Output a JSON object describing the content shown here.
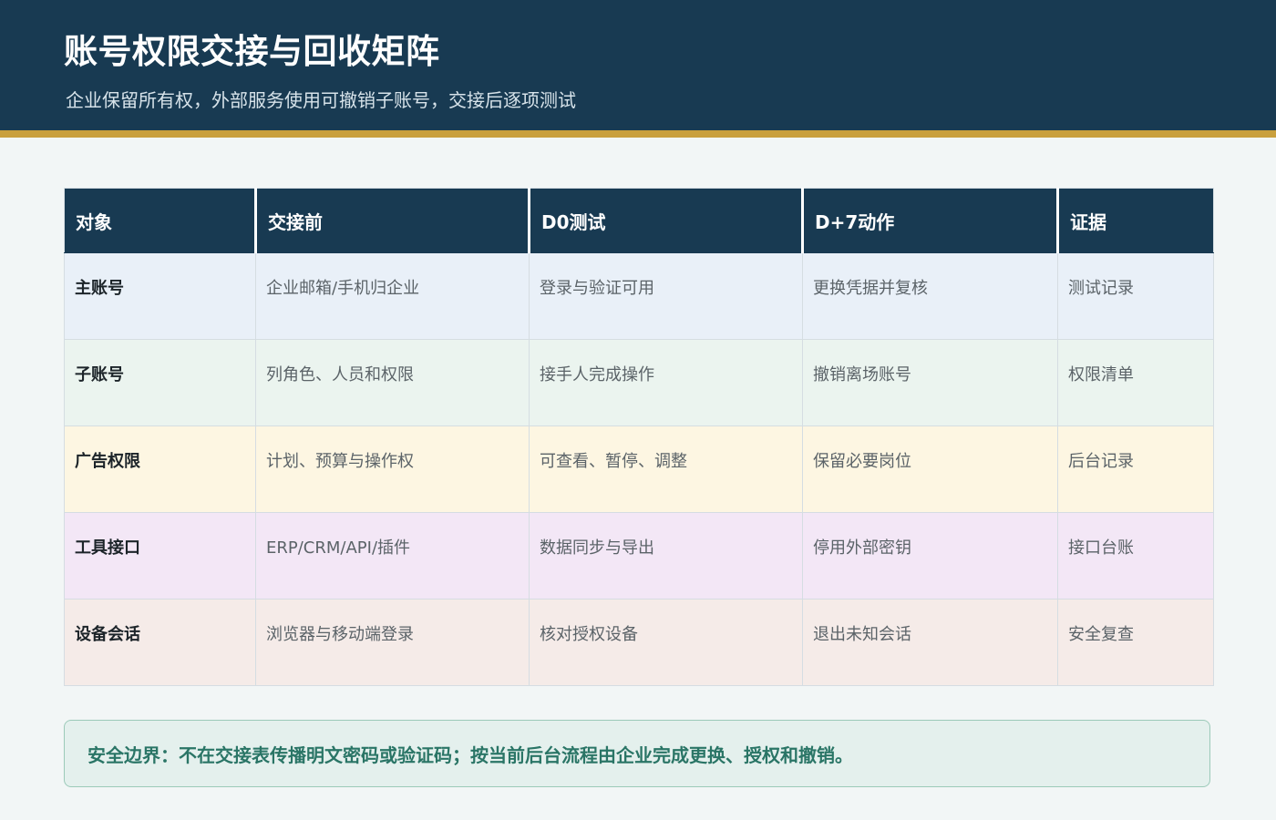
{
  "header": {
    "title": "账号权限交接与回收矩阵",
    "subtitle": "企业保留所有权，外部服务使用可撤销子账号，交接后逐项测试"
  },
  "table": {
    "columns": [
      "对象",
      "交接前",
      "D0测试",
      "D+7动作",
      "证据"
    ],
    "rows": [
      [
        "主账号",
        "企业邮箱/手机归企业",
        "登录与验证可用",
        "更换凭据并复核",
        "测试记录"
      ],
      [
        "子账号",
        "列角色、人员和权限",
        "接手人完成操作",
        "撤销离场账号",
        "权限清单"
      ],
      [
        "广告权限",
        "计划、预算与操作权",
        "可查看、暂停、调整",
        "保留必要岗位",
        "后台记录"
      ],
      [
        "工具接口",
        "ERP/CRM/API/插件",
        "数据同步与导出",
        "停用外部密钥",
        "接口台账"
      ],
      [
        "设备会话",
        "浏览器与移动端登录",
        "核对授权设备",
        "退出未知会话",
        "安全复查"
      ]
    ]
  },
  "notice": {
    "text": "安全边界：不在交接表传播明文密码或验证码；按当前后台流程由企业完成更换、授权和撤销。"
  },
  "colors": {
    "header_bg": "#183a52",
    "accent_bar": "#c9a03d",
    "row_backgrounds": [
      "#e9f0f8",
      "#ebf4ef",
      "#fdf6e2",
      "#f3e7f6",
      "#f5ebe8"
    ],
    "notice_text": "#2a7566"
  }
}
